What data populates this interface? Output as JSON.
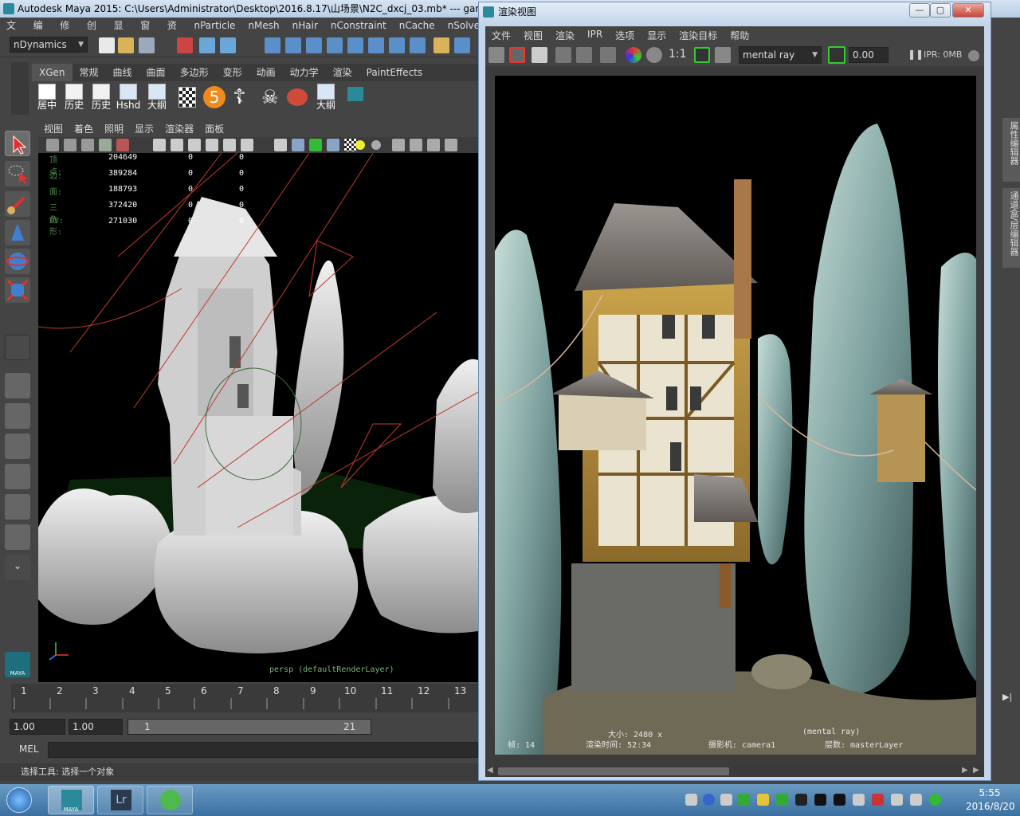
{
  "maya": {
    "title": "Autodesk Maya 2015: C:\\Users\\Administrator\\Desktop\\2016.8.17\\山场景\\N2C_dxcj_03.mb*  ---  gar",
    "menu": [
      "文件",
      "编辑",
      "修改",
      "创建",
      "显示",
      "窗口",
      "资源",
      "nParticle",
      "nMesh",
      "nHair",
      "nConstraint",
      "nCache",
      "nSolve"
    ],
    "menu_set": "nDynamics",
    "shelf_tabs": [
      "XGen",
      "常规",
      "曲线",
      "曲面",
      "多边形",
      "变形",
      "动画",
      "动力学",
      "渲染",
      "PaintEffects"
    ],
    "shelf_active": "XGen",
    "shelf_buttons": [
      "居中",
      "历史",
      "历史",
      "Hshd",
      "大纲",
      "",
      "",
      "",
      "",
      "大纲",
      ""
    ],
    "shelf_icon_5": "5",
    "viewport_menu": [
      "视图",
      "着色",
      "照明",
      "显示",
      "渲染器",
      "面板"
    ],
    "hud": [
      {
        "label": "顶点:",
        "v1": "204649",
        "v2": "0",
        "v3": "0"
      },
      {
        "label": "边:",
        "v1": "389284",
        "v2": "0",
        "v3": "0"
      },
      {
        "label": "面:",
        "v1": "188793",
        "v2": "0",
        "v3": "0"
      },
      {
        "label": "三角形:",
        "v1": "372420",
        "v2": "0",
        "v3": "0"
      },
      {
        "label": "UV:",
        "v1": "271030",
        "v2": "0",
        "v3": "0"
      }
    ],
    "viewport_label": "persp (defaultRenderLayer)",
    "timeline_ticks": [
      "1",
      "2",
      "3",
      "4",
      "5",
      "6",
      "7",
      "8",
      "9",
      "10",
      "11",
      "12",
      "13"
    ],
    "range_start": "1.00",
    "range_current": "1.00",
    "range_slider_start": "1",
    "range_slider_end": "21",
    "mel_label": "MEL",
    "help_text": "选择工具: 选择一个对象",
    "side_tab_1": "属性编辑器",
    "side_tab_2": "通道盒/层编辑器",
    "maya_logo": "MAYA"
  },
  "render_view": {
    "title": "渲染视图",
    "menu": [
      "文件",
      "视图",
      "渲染",
      "IPR",
      "选项",
      "显示",
      "渲染目标",
      "帮助"
    ],
    "ratio": "1:1",
    "renderer": "mental ray",
    "exposure": "0.00",
    "ipr_mem": "IPR: 0MB",
    "info": {
      "size": "大小: 2480 x",
      "renderer": "(mental ray)",
      "frame": "帧: 14",
      "time": "渲染时间: 52:34",
      "camera": "摄影机: camera1",
      "layer": "层数: masterLayer"
    }
  },
  "taskbar": {
    "apps": [
      "MAYA",
      "Lr",
      ""
    ],
    "time": "5:55",
    "date": "2016/8/20"
  },
  "colors": {
    "maya_bg": "#444444",
    "viewport_bg": "#000000",
    "accent_teal": "#2a8a9a",
    "taskbar": "#3a6fa0"
  }
}
